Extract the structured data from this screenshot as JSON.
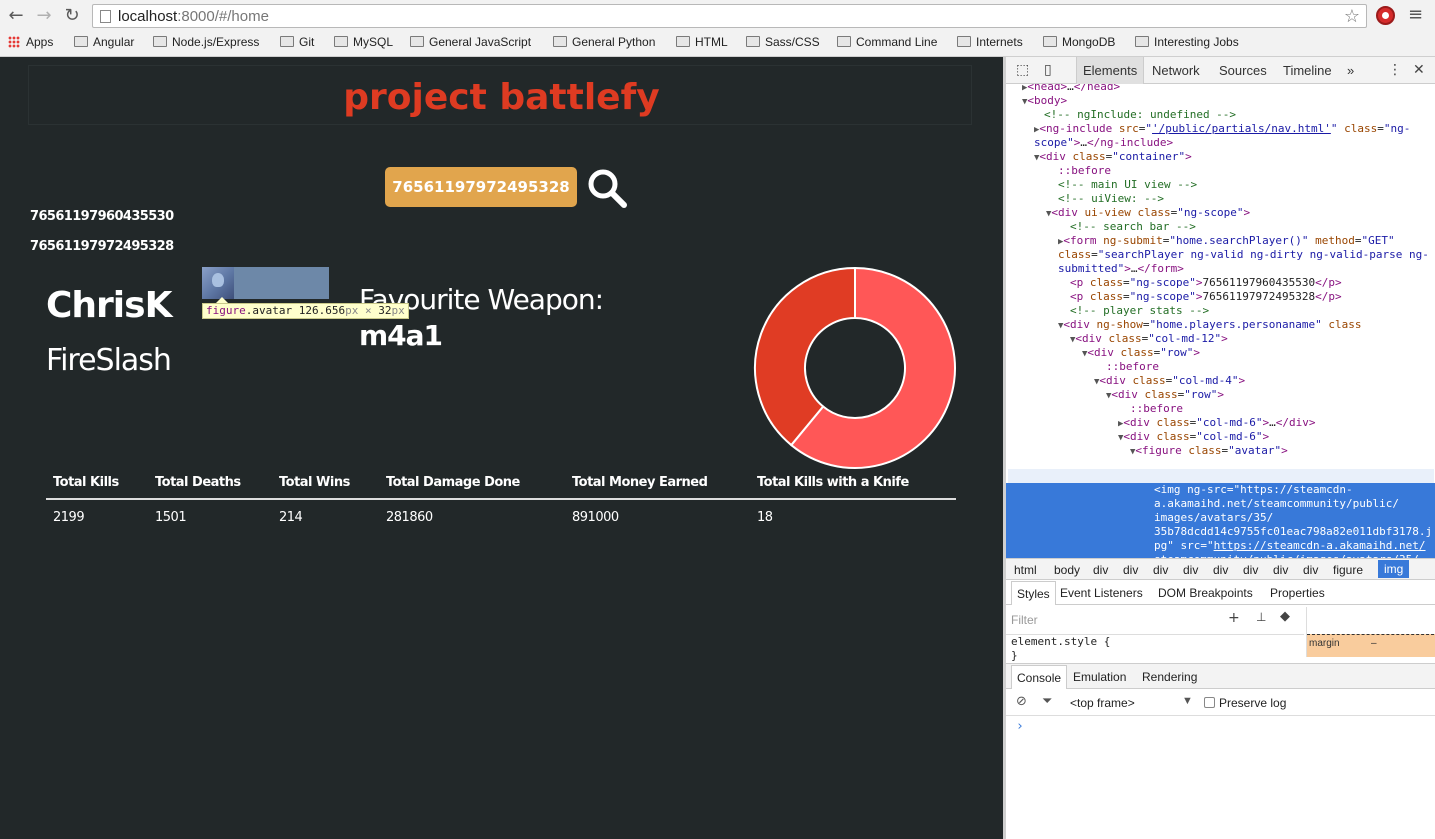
{
  "browser": {
    "url_host": "localhost",
    "url_rest": ":8000/#/home",
    "bookmarks": [
      "Apps",
      "Angular",
      "Node.js/Express",
      "Git",
      "MySQL",
      "General JavaScript",
      "General Python",
      "HTML",
      "Sass/CSS",
      "Command Line",
      "Internets",
      "MongoDB",
      "Interesting Jobs"
    ]
  },
  "app": {
    "title": "project battlefy",
    "search_value": "76561197972495328",
    "steam_ids": [
      "76561197960435530",
      "76561197972495328"
    ],
    "player_name": "ChrisK",
    "player_alias": "FireSlash",
    "fav_weapon_label": "Favourite Weapon:",
    "fav_weapon_value": "m4a1",
    "inspect_tip": {
      "tag": "figure",
      "cls": ".avatar",
      "w": "126.656",
      "h": "32",
      "unit": "px",
      "times": " × "
    },
    "donut": {
      "colors": [
        "#ff5757",
        "#e03c24"
      ],
      "values": [
        0.61,
        0.39
      ]
    },
    "stats": {
      "headers": [
        "Total Kills",
        "Total Deaths",
        "Total Wins",
        "Total Damage Done",
        "Total Money Earned",
        "Total Kills with a Knife"
      ],
      "values": [
        "2199",
        "1501",
        "214",
        "281860",
        "891000",
        "18"
      ]
    }
  },
  "devtools": {
    "tabs": [
      "Elements",
      "Network",
      "Sources",
      "Timeline",
      "»"
    ],
    "breadcrumbs": [
      "html",
      "body",
      "div",
      "div",
      "div",
      "div",
      "div",
      "div",
      "div",
      "div",
      "figure",
      "img"
    ],
    "style_tabs": [
      "Styles",
      "Event Listeners",
      "DOM Breakpoints",
      "Properties"
    ],
    "filter_placeholder": "Filter",
    "element_style_1": "element.style {",
    "element_style_2": "}",
    "box_margin_label": "margin",
    "box_margin_value": "–",
    "console_tabs": [
      "Console",
      "Emulation",
      "Rendering"
    ],
    "frame_select": "<top frame>",
    "preserve_log": "Preserve log",
    "prompt": "›"
  }
}
